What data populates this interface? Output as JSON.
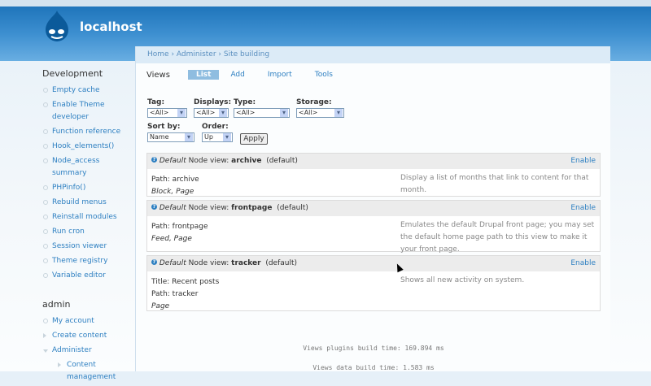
{
  "site": {
    "name": "localhost"
  },
  "breadcrumb": "Home › Administer › Site building",
  "sidebar": {
    "development": {
      "title": "Development",
      "items": [
        "Empty cache",
        "Enable Theme developer",
        "Function reference",
        "Hook_elements()",
        "Node_access summary",
        "PHPinfo()",
        "Rebuild menus",
        "Reinstall modules",
        "Run cron",
        "Session viewer",
        "Theme registry",
        "Variable editor"
      ]
    },
    "admin": {
      "title": "admin",
      "items": [
        {
          "label": "My account",
          "type": "leaf"
        },
        {
          "label": "Create content",
          "type": "collapsed"
        },
        {
          "label": "Administer",
          "type": "expanded"
        },
        {
          "label": "Content management",
          "type": "collapsed",
          "sub": true
        }
      ]
    }
  },
  "tabs": {
    "title": "Views",
    "items": [
      "List",
      "Add",
      "Import",
      "Tools"
    ],
    "active": "List"
  },
  "filters": {
    "tag": {
      "label": "Tag:",
      "value": "<All>"
    },
    "displays": {
      "label": "Displays:",
      "value": "<All>"
    },
    "type": {
      "label": "Type:",
      "value": "<All>"
    },
    "storage": {
      "label": "Storage:",
      "value": "<All>"
    },
    "sort": {
      "label": "Sort by:",
      "value": "Name"
    },
    "order": {
      "label": "Order:",
      "value": "Up"
    },
    "apply": "Apply"
  },
  "views": [
    {
      "prefix": "Default",
      "type": "Node view:",
      "name": "archive",
      "status": "(default)",
      "action": "Enable",
      "lines": [
        "Path: archive"
      ],
      "displays": "Block, Page",
      "description": "Display a list of months that link to content for that month."
    },
    {
      "prefix": "Default",
      "type": "Node view:",
      "name": "frontpage",
      "status": "(default)",
      "action": "Enable",
      "lines": [
        "Path: frontpage"
      ],
      "displays": "Feed, Page",
      "description": "Emulates the default Drupal front page; you may set the default home page path to this view to make it your front page."
    },
    {
      "prefix": "Default",
      "type": "Node view:",
      "name": "tracker",
      "status": "(default)",
      "action": "Enable",
      "lines": [
        "Title: Recent posts",
        "Path: tracker"
      ],
      "displays": "Page",
      "description": "Shows all new activity on system."
    }
  ],
  "footer": {
    "plugins": "Views plugins build time: 169.894 ms",
    "data": "Views data build time: 1.583 ms"
  },
  "colors": {
    "header": "#2f83c8",
    "link": "#2d7fc1",
    "active_tab": "#8fbde0"
  }
}
